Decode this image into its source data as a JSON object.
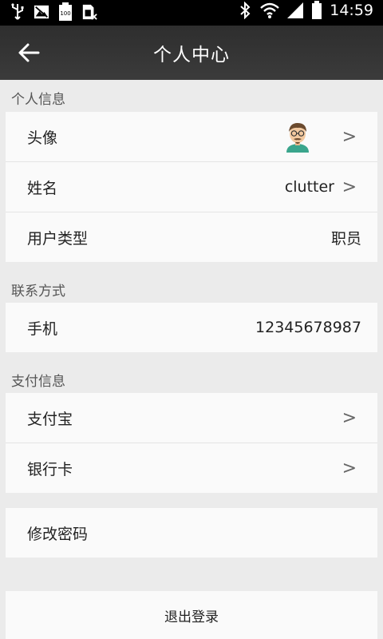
{
  "status_bar": {
    "battery_level_text": "100",
    "time": "14:59"
  },
  "header": {
    "title": "个人中心"
  },
  "sections": {
    "personal": {
      "label": "个人信息",
      "avatar_label": "头像",
      "avatar_chevron": ">",
      "name_label": "姓名",
      "name_value": "clutter",
      "name_chevron": ">",
      "user_type_label": "用户类型",
      "user_type_value": "职员"
    },
    "contact": {
      "label": "联系方式",
      "phone_label": "手机",
      "phone_value": "12345678987"
    },
    "payment": {
      "label": "支付信息",
      "alipay_label": "支付宝",
      "alipay_chevron": ">",
      "bank_label": "银行卡",
      "bank_chevron": ">"
    },
    "security": {
      "change_password_label": "修改密码"
    }
  },
  "footer": {
    "logout_label": "退出登录"
  }
}
